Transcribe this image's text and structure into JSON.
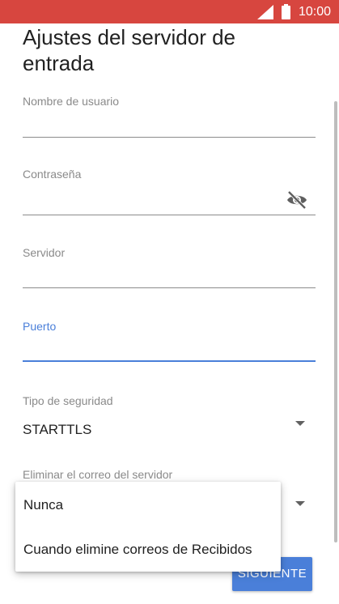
{
  "status_bar": {
    "time": "10:00",
    "icons": [
      "signal-icon",
      "battery-icon"
    ],
    "background": "#d7463f"
  },
  "page": {
    "title": "Ajustes del servidor de entrada"
  },
  "form": {
    "username": {
      "label": "Nombre de usuario",
      "value": ""
    },
    "password": {
      "label": "Contraseña",
      "value": "",
      "toggle_icon": "visibility-off-icon"
    },
    "server": {
      "label": "Servidor",
      "value": ""
    },
    "port": {
      "label": "Puerto",
      "value": "",
      "focused": true
    },
    "security_type": {
      "label": "Tipo de seguridad",
      "value": "STARTTLS"
    },
    "delete_from_server": {
      "label": "Eliminar el correo del servidor"
    }
  },
  "menu": {
    "options": [
      "Nunca",
      "Cuando elimine correos de Recibidos"
    ]
  },
  "buttons": {
    "next": "SIGUIENTE"
  },
  "colors": {
    "accent": "#4a7fd9",
    "status_bar": "#d7463f"
  }
}
